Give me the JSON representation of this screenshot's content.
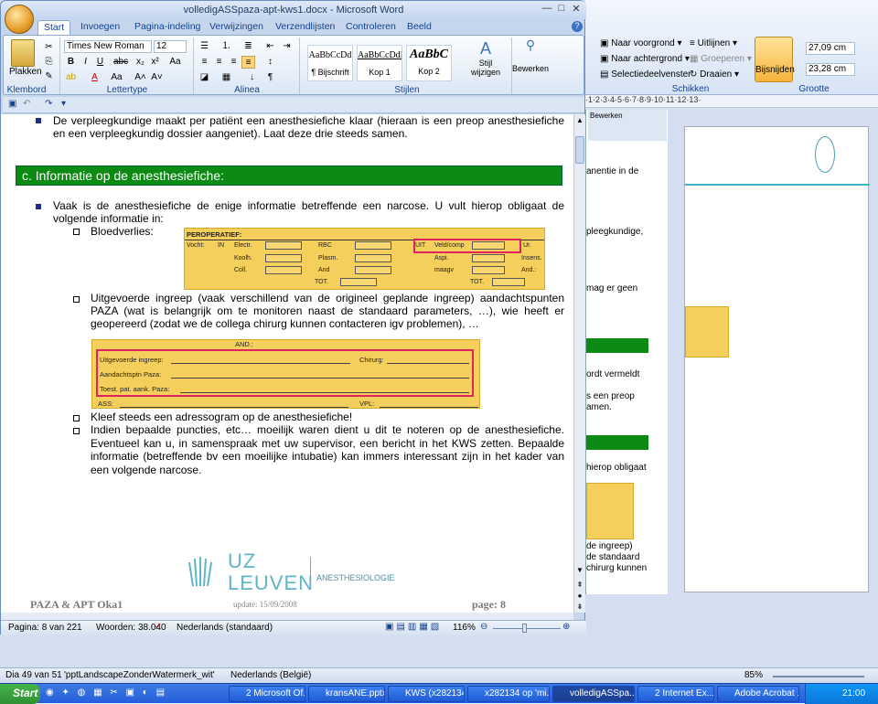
{
  "background_window": {
    "ribbon": {
      "arrange_group_title": "Schikken",
      "size_group_title": "Grootte",
      "bring_forward": "Naar voorgrond",
      "send_backward": "Naar achtergrond",
      "selection_pane": "Selectiedeelvenster",
      "align": "Uitlijnen",
      "group": "Groeperen",
      "rotate": "Draaien",
      "crop": "Bijsnijden",
      "height": "27,09 cm",
      "width": "23,28 cm",
      "edit_label": "Bewerken"
    },
    "ruler_text": "·1·2·3·4·5·6·7·8·9·10·11·12·13·",
    "side_doc_lines": [
      "anentie in de",
      "pleegkundige,",
      "mag er geen",
      "ordt vermeldt",
      "s een preop",
      "amen.",
      "hierop obligaat",
      "de ingreep)",
      "de standaard",
      "chirurg kunnen"
    ],
    "status": {
      "slide_info": "Dia 49 van 51",
      "theme": "'pptLandscapeZonderWatermerk_wit'",
      "language": "Nederlands (België)",
      "zoom": "85%"
    }
  },
  "taskbar": {
    "start": "Start",
    "buttons": [
      "2 Microsoft Of...",
      "kransANE.pptx",
      "KWS (x282134)",
      "x282134 op 'mi...",
      "volledigASSpa...",
      "2 Internet Ex...",
      "Adobe Acrobat ..."
    ],
    "active_index": 4,
    "clock": "21:00"
  },
  "word": {
    "title": "volledigASSpaza-apt-kws1.docx - Microsoft Word",
    "tabs": [
      "Start",
      "Invoegen",
      "Pagina-indeling",
      "Verwijzingen",
      "Verzendlijsten",
      "Controleren",
      "Beeld"
    ],
    "active_tab": "Start",
    "ribbon": {
      "clipboard_title": "Klembord",
      "paste_label": "Plakken",
      "font_title": "Lettertype",
      "font_name": "Times New Roman",
      "font_size": "12",
      "paragraph_title": "Alinea",
      "styles_title": "Stijlen",
      "styles": [
        {
          "sample": "AaBbCcDd",
          "name": "¶ Bijschrift"
        },
        {
          "sample": "AaBbCcDdE",
          "name": "Kop 1"
        },
        {
          "sample": "AaBbC",
          "name": "Kop 2"
        }
      ],
      "change_styles": "Stijl wijzigen",
      "editing": "Bewerken"
    },
    "status": {
      "page": "Pagina: 8 van 221",
      "words": "Woorden: 38.040",
      "language": "Nederlands (standaard)",
      "zoom": "116%"
    },
    "document": {
      "top_bullet": "De verpleegkundige maakt per patiënt een anesthesiefiche klaar (hieraan is een preop anesthesiefiche en een verpleegkundig dossier aangeniet). Laat deze drie steeds samen.",
      "heading": "c. Informatie op de anesthesiefiche:",
      "intro": "Vaak is de anesthesiefiche de enige informatie betreffende een narcose. U vult hierop obligaat de volgende informatie in:",
      "items": [
        "Bloedverlies:",
        "Uitgevoerde ingreep (vaak verschillend van de origineel geplande ingreep) aandachtspunten PAZA (wat is belangrijk om te monitoren naast de standaard parameters, …), wie heeft er geopereerd (zodat we de collega chirurg kunnen contacteren igv problemen), …",
        "Kleef steeds een adressogram op de anesthesiefiche!",
        "Indien bepaalde puncties, etc… moeilijk waren dient u dit te noteren op de anesthesiefiche. Eventueel kan u, in samenspraak met uw supervisor, een bericht in het KWS zetten. Bepaalde informatie (betreffende bv een moeilijke intubatie) kan immers interessant zijn in het kader van een volgende narcose."
      ],
      "form1": {
        "title": "PEROPERATIEF:",
        "vocht": "Vocht:",
        "in": "IN",
        "left_labels": [
          "Electr.",
          "Koolh.",
          "Coll."
        ],
        "mid_labels": [
          "RBC",
          "Plasm.",
          "And"
        ],
        "right_labels": [
          "Veld/comp",
          "Aspi.",
          "maagv"
        ],
        "uit": "UIT",
        "far_right": [
          "Ur.",
          "Insens.",
          "And.:"
        ],
        "tot": "TOT."
      },
      "form2": {
        "and": "AND.:",
        "ingreep": "Uitgevoerde ingreep:",
        "chirurg": "Chirurg:",
        "aandacht": "Aandachtsptn Paza:",
        "toest": "Toest. pat. aank. Paza:",
        "ass": "ASS:",
        "vpl": "VPL:"
      },
      "footer_left": "PAZA & APT Oka1",
      "footer_center": "update: 15/09/2008",
      "footer_right": "page: 8",
      "logo_main": "UZ",
      "logo_sub": "LEUVEN",
      "logo_dept": "ANESTHESIOLOGIE"
    }
  }
}
